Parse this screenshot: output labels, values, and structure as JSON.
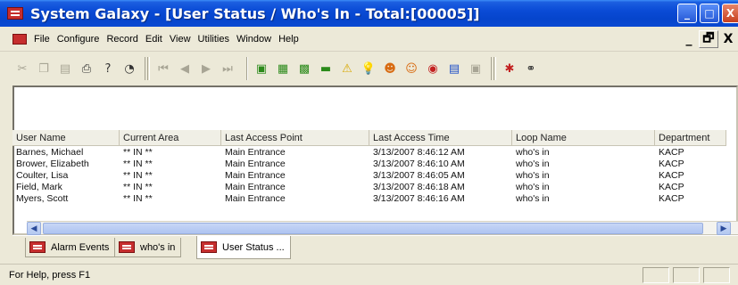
{
  "window": {
    "title": "System Galaxy - [User Status / Who's In - Total:[00005]]",
    "minimize_glyph": "_",
    "maximize_glyph": "□",
    "close_glyph": "X"
  },
  "menu": {
    "items": [
      "File",
      "Configure",
      "Record",
      "Edit",
      "View",
      "Utilities",
      "Window",
      "Help"
    ],
    "mdi_minimize": "_",
    "mdi_restore": "🗗",
    "mdi_close": "X"
  },
  "toolbar": {
    "icons": [
      "cut-icon",
      "copy-icon",
      "paste-icon",
      "print-icon",
      "help-icon",
      "stopwatch-icon",
      "first-record-icon",
      "prev-record-icon",
      "next-record-icon",
      "last-record-icon",
      "door-icon",
      "reader-icon",
      "reader-group-icon",
      "panel-icon",
      "alarm-warning-icon",
      "light-bulb-icon",
      "user-icon",
      "users-icon",
      "clock-icon",
      "card-icon",
      "badge-icon",
      "events-icon",
      "binoculars-icon"
    ]
  },
  "table": {
    "columns": [
      "User Name",
      "Current Area",
      "Last Access Point",
      "Last Access Time",
      "Loop Name",
      "Department"
    ],
    "rows": [
      [
        "Barnes, Michael",
        "** IN **",
        "Main Entrance",
        "3/13/2007 8:46:12 AM",
        "who's in",
        "KACP"
      ],
      [
        "Brower, Elizabeth",
        "** IN **",
        "Main Entrance",
        "3/13/2007 8:46:10 AM",
        "who's in",
        "KACP"
      ],
      [
        "Coulter, Lisa",
        "** IN **",
        "Main Entrance",
        "3/13/2007 8:46:05 AM",
        "who's in",
        "KACP"
      ],
      [
        "Field, Mark",
        "** IN **",
        "Main Entrance",
        "3/13/2007 8:46:18 AM",
        "who's in",
        "KACP"
      ],
      [
        "Myers, Scott",
        "** IN **",
        "Main Entrance",
        "3/13/2007 8:46:16 AM",
        "who's in",
        "KACP"
      ]
    ]
  },
  "scrollbar": {
    "left_arrow": "◀",
    "right_arrow": "▶"
  },
  "tabs": [
    {
      "label": "Alarm Events"
    },
    {
      "label": "who's in"
    },
    {
      "label": "User Status ..."
    }
  ],
  "status": {
    "text": "For Help, press F1"
  },
  "colors": {
    "titlebar": "#0a4bd6",
    "face": "#ece9d8",
    "accent_red": "#c62e2e"
  }
}
